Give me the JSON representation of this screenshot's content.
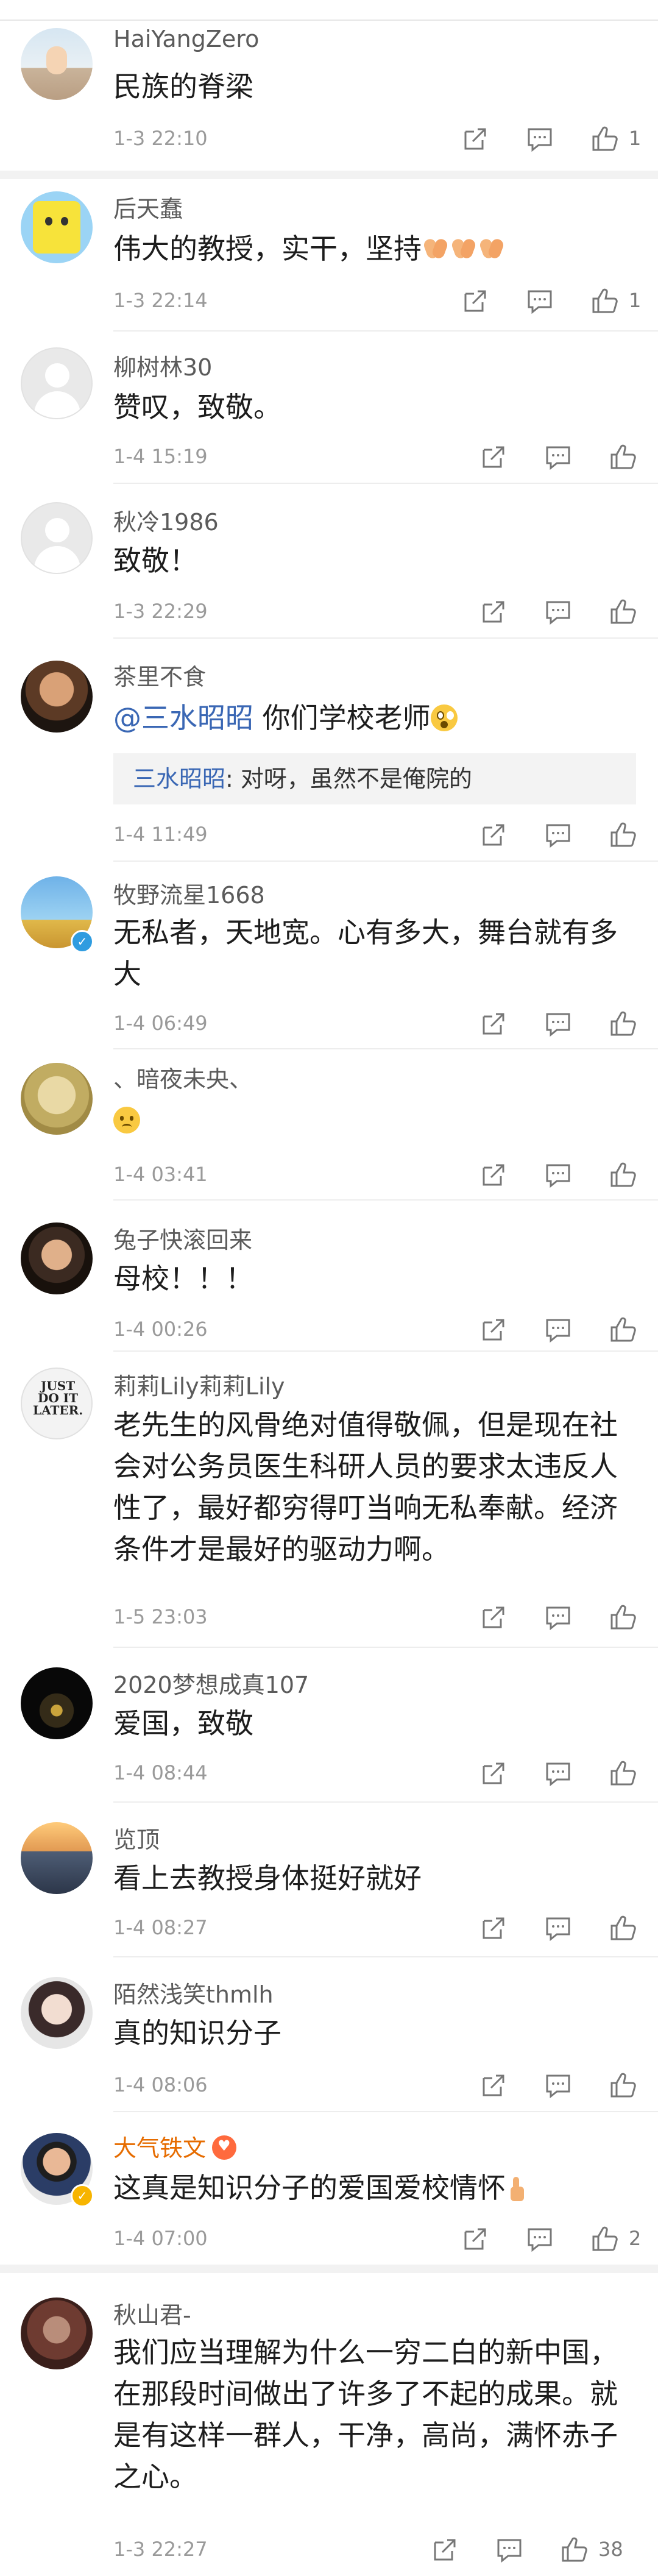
{
  "comments": [
    {
      "username": "HaiYangZero",
      "text": "民族的脊梁",
      "time": "1-3 22:10",
      "likes": "1"
    },
    {
      "username": "后天蠢",
      "text": "伟大的教授，实干，坚持",
      "time": "1-3 22:14",
      "likes": "1"
    },
    {
      "username": "柳树林30",
      "text": "赞叹，致敬。",
      "time": "1-4 15:19",
      "likes": ""
    },
    {
      "username": "秋冷1986",
      "text": "致敬！",
      "time": "1-3 22:29",
      "likes": ""
    },
    {
      "username": "茶里不食",
      "mention": "@三水昭昭",
      "text": " 你们学校老师",
      "reply_name": "三水昭昭",
      "reply_text": ": 对呀，虽然不是俺院的",
      "time": "1-4 11:49",
      "likes": ""
    },
    {
      "username": "牧野流星1668",
      "text": "无私者，天地宽。心有多大，舞台就有多大",
      "time": "1-4 06:49",
      "likes": ""
    },
    {
      "username": "、暗夜未央、",
      "text": "",
      "time": "1-4 03:41",
      "likes": ""
    },
    {
      "username": "兔子快滚回来",
      "text": "母校！！！",
      "time": "1-4 00:26",
      "likes": ""
    },
    {
      "username": "莉莉Lily莉莉Lily",
      "text": "老先生的风骨绝对值得敬佩，但是现在社会对公务员医生科研人员的要求太违反人性了，最好都穷得叮当响无私奉献。经济条件才是最好的驱动力啊。",
      "time": "1-5 23:03",
      "likes": "",
      "avatar_text": "JUST DO IT LATER."
    },
    {
      "username": "2020梦想成真107",
      "text": "爱国，致敬",
      "time": "1-4 08:44",
      "likes": ""
    },
    {
      "username": "览顶",
      "text": "看上去教授身体挺好就好",
      "time": "1-4 08:27",
      "likes": ""
    },
    {
      "username": "陌然浅笑thmlh",
      "text": "真的知识分子",
      "time": "1-4 08:06",
      "likes": ""
    },
    {
      "username": "大气铁文",
      "text": "这真是知识分子的爱国爱校情怀",
      "time": "1-4 07:00",
      "likes": "2"
    },
    {
      "username": "秋山君-",
      "text": "我们应当理解为什么一穷二白的新中国，在那段时间做出了许多了不起的成果。就是有这样一群人，干净，高尚，满怀赤子之心。",
      "time": "1-3 22:27",
      "likes": "38"
    }
  ],
  "icons": {
    "share": "share-icon",
    "comment": "comment-icon",
    "like": "thumbs-up-icon"
  },
  "colors": {
    "username": "#5b5b5b",
    "vip_username": "#e66c00",
    "mention": "#3a67b4",
    "time": "#9a9a9a"
  }
}
